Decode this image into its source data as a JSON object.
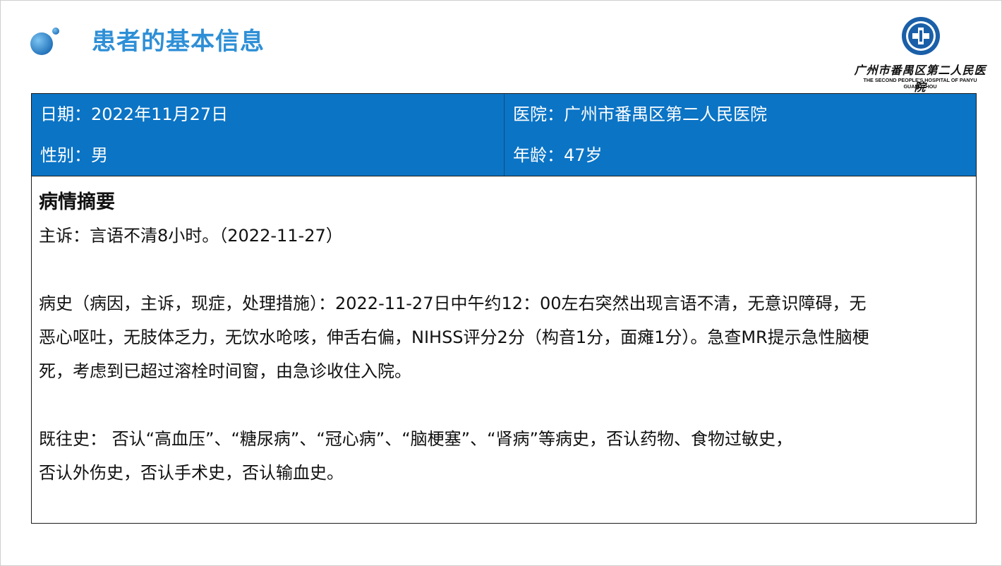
{
  "header": {
    "title": "患者的基本信息"
  },
  "logo": {
    "name_cn": "广州市番禺区第二人民医院",
    "name_en": "THE SECOND PEOPLE'S HOSPITAL OF PANYU GUANGZHOU"
  },
  "info": {
    "date": "日期：2022年11月27日",
    "hospital": "医院：广州市番禺区第二人民医院",
    "gender": "性别：男",
    "age": "年龄：47岁"
  },
  "summary": {
    "title": "病情摘要",
    "chief_complaint": "主诉：言语不清8小时。（2022-11-27）",
    "history_lines": [
      "病史（病因，主诉，现症，处理措施）：2022-11-27日中午约12：00左右突然出现言语不清，无意识障碍，无",
      "恶心呕吐，无肢体乏力，无饮水呛咳，伸舌右偏，NIHSS评分2分（构音1分，面瘫1分）。急查MR提示急性脑梗",
      "死，考虑到已超过溶栓时间窗，由急诊收住入院。"
    ],
    "past_history_lines": [
      "既往史： 否认“高血压”、“糖尿病”、“冠心病”、“脑梗塞”、“肾病”等病史，否认药物、食物过敏史，",
      "否认外伤史，否认手术史，否认输血史。"
    ]
  },
  "colors": {
    "title_blue": "#2e8fd6",
    "header_row_blue": "#0b74c5"
  }
}
